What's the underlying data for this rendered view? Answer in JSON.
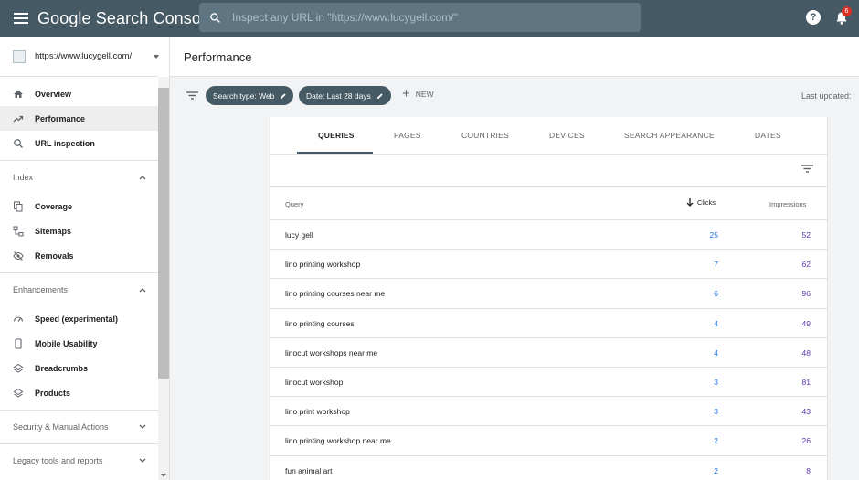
{
  "app": {
    "title": "Google Search Console",
    "search_placeholder": "Inspect any URL in \"https://www.lucygell.com/\"",
    "notification_count": "6"
  },
  "sidebar": {
    "property": "https://www.lucygell.com/",
    "top_items": [
      {
        "label": "Overview",
        "icon": "home-icon"
      },
      {
        "label": "Performance",
        "icon": "trending-up-icon"
      },
      {
        "label": "URL inspection",
        "icon": "search-icon"
      }
    ],
    "index": {
      "heading": "Index",
      "items": [
        {
          "label": "Coverage",
          "icon": "copy-icon"
        },
        {
          "label": "Sitemaps",
          "icon": "sitemap-icon"
        },
        {
          "label": "Removals",
          "icon": "eye-off-icon"
        }
      ]
    },
    "enhancements": {
      "heading": "Enhancements",
      "items": [
        {
          "label": "Speed (experimental)",
          "icon": "speed-icon"
        },
        {
          "label": "Mobile Usability",
          "icon": "phone-icon"
        },
        {
          "label": "Breadcrumbs",
          "icon": "layers-icon"
        },
        {
          "label": "Products",
          "icon": "layers-icon"
        }
      ]
    },
    "security": "Security & Manual Actions",
    "legacy": "Legacy tools and reports"
  },
  "page": {
    "title": "Performance",
    "filters": {
      "chip_search_type": "Search type: Web",
      "chip_date": "Date: Last 28 days",
      "new_label": "NEW",
      "last_updated": "Last updated:"
    }
  },
  "tabs": [
    "QUERIES",
    "PAGES",
    "COUNTRIES",
    "DEVICES",
    "SEARCH APPEARANCE",
    "DATES"
  ],
  "table": {
    "headers": {
      "query": "Query",
      "clicks": "Clicks",
      "impressions": "Impressions"
    },
    "rows": [
      {
        "query": "lucy gell",
        "clicks": "25",
        "impressions": "52"
      },
      {
        "query": "lino printing workshop",
        "clicks": "7",
        "impressions": "62"
      },
      {
        "query": "lino printing courses near me",
        "clicks": "6",
        "impressions": "96"
      },
      {
        "query": "lino printing courses",
        "clicks": "4",
        "impressions": "49"
      },
      {
        "query": "linocut workshops near me",
        "clicks": "4",
        "impressions": "48"
      },
      {
        "query": "linocut workshop",
        "clicks": "3",
        "impressions": "81"
      },
      {
        "query": "lino print workshop",
        "clicks": "3",
        "impressions": "43"
      },
      {
        "query": "lino printing workshop near me",
        "clicks": "2",
        "impressions": "26"
      },
      {
        "query": "fun animal art",
        "clicks": "2",
        "impressions": "8"
      }
    ]
  },
  "colors": {
    "topbar": "#455a64",
    "clicks": "#1a73e8",
    "impressions": "#5e35b1",
    "badge": "#d93025"
  }
}
